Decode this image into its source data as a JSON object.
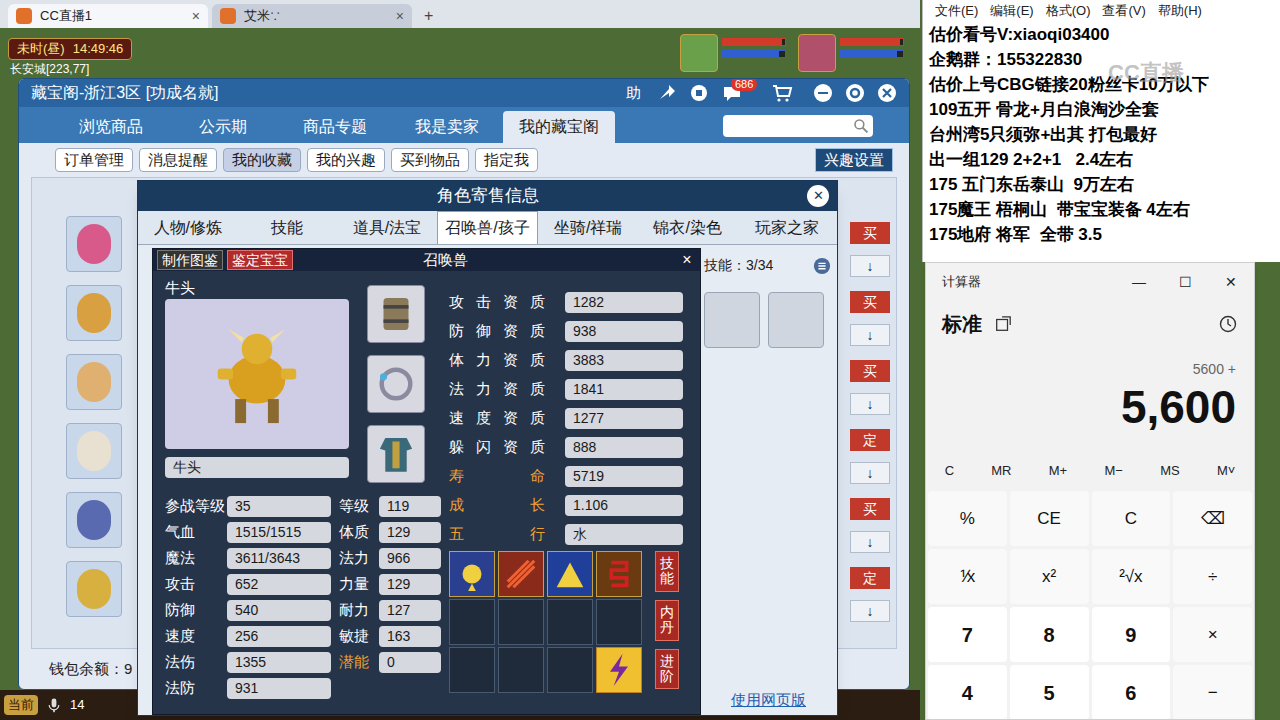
{
  "browser_tabs": [
    {
      "label": "CC直播1",
      "close": "×",
      "selected": true
    },
    {
      "label": "艾米∵",
      "close": "×",
      "selected": false
    }
  ],
  "browser_new_tab": "+",
  "hud": {
    "period": "未时(昼)",
    "clock": "14:49:46",
    "location": "长安城[223,77]",
    "bars": [
      {
        "level": 0.95,
        "color": "#d23a2a"
      },
      {
        "level": 0.9,
        "color": "#2f5fd0"
      },
      {
        "level": 0.95,
        "color": "#d23a2a"
      },
      {
        "level": 0.9,
        "color": "#2f5fd0"
      }
    ]
  },
  "cbg_window": {
    "title": "藏宝阁-浙江3区 [功成名就]",
    "help": "助",
    "badge": "686",
    "tabs": [
      {
        "label": "浏览商品",
        "selected": false
      },
      {
        "label": "公示期",
        "selected": false
      },
      {
        "label": "商品专题",
        "selected": false
      },
      {
        "label": "我是卖家",
        "selected": false
      },
      {
        "label": "我的藏宝阁",
        "selected": true
      }
    ],
    "subtabs": [
      {
        "label": "订单管理",
        "selected": false
      },
      {
        "label": "消息提醒",
        "selected": false
      },
      {
        "label": "我的收藏",
        "selected": true
      },
      {
        "label": "我的兴趣",
        "selected": false
      },
      {
        "label": "买到物品",
        "selected": false
      },
      {
        "label": "指定我",
        "selected": false
      }
    ],
    "interest_settings": "兴趣设置",
    "rows": [
      {
        "button": "买",
        "sort": "↓"
      },
      {
        "button": "买",
        "sort": "↓"
      },
      {
        "button": "买",
        "sort": "↓"
      },
      {
        "button": "定",
        "sort": "↓"
      },
      {
        "button": "买",
        "sort": "↓"
      },
      {
        "button": "定",
        "sort": "↓"
      }
    ],
    "wallet": "钱包余额：9"
  },
  "dialog": {
    "title": "角色寄售信息",
    "close": "✕",
    "tabs": [
      {
        "label": "人物/修炼",
        "selected": false
      },
      {
        "label": "技能",
        "selected": false
      },
      {
        "label": "道具/法宝",
        "selected": false
      },
      {
        "label": "召唤兽/孩子",
        "selected": true
      },
      {
        "label": "坐骑/祥瑞",
        "selected": false
      },
      {
        "label": "锦衣/染色",
        "selected": false
      },
      {
        "label": "玩家之家",
        "selected": false
      }
    ],
    "skill_count": "技能：3/34",
    "web_link": "使用网页版"
  },
  "pet_window": {
    "make_atlas": "制作图鉴",
    "identify": "鉴定宝宝",
    "title": "召唤兽",
    "close": "×",
    "name": "牛头",
    "name_field": "牛头",
    "equipment": [
      {
        "filled": true
      },
      {
        "filled": true
      },
      {
        "filled": true
      }
    ],
    "stats": [
      [
        {
          "label": "参战等级",
          "value": "35",
          "color": "#ffffff"
        },
        {
          "label": "等级",
          "value": "119",
          "color": "#ffffff"
        }
      ],
      [
        {
          "label": "气血",
          "value": "1515/1515",
          "color": "#ffffff"
        },
        {
          "label": "体质",
          "value": "129",
          "color": "#ffffff"
        }
      ],
      [
        {
          "label": "魔法",
          "value": "3611/3643",
          "color": "#ffffff"
        },
        {
          "label": "法力",
          "value": "966",
          "color": "#ffffff"
        }
      ],
      [
        {
          "label": "攻击",
          "value": "652",
          "color": "#ffffff"
        },
        {
          "label": "力量",
          "value": "129",
          "color": "#ffffff"
        }
      ],
      [
        {
          "label": "防御",
          "value": "540",
          "color": "#ffffff"
        },
        {
          "label": "耐力",
          "value": "127",
          "color": "#ffffff"
        }
      ],
      [
        {
          "label": "速度",
          "value": "256",
          "color": "#ffffff"
        },
        {
          "label": "敏捷",
          "value": "163",
          "color": "#ffffff"
        }
      ],
      [
        {
          "label": "法伤",
          "value": "1355",
          "color": "#ffffff"
        },
        {
          "label": "潜能",
          "value": "0",
          "color": "#f0a030"
        }
      ],
      [
        {
          "label": "法防",
          "value": "931",
          "color": "#ffffff"
        }
      ]
    ],
    "aptitudes": [
      {
        "label": "攻击资质",
        "value": "1282",
        "color": "#ffffff"
      },
      {
        "label": "防御资质",
        "value": "938",
        "color": "#ffffff"
      },
      {
        "label": "体力资质",
        "value": "3883",
        "color": "#ffffff"
      },
      {
        "label": "法力资质",
        "value": "1841",
        "color": "#ffffff"
      },
      {
        "label": "速度资质",
        "value": "1277",
        "color": "#ffffff"
      },
      {
        "label": "躲闪资质",
        "value": "888",
        "color": "#ffffff"
      },
      {
        "label": "寿命",
        "value": "5719",
        "color": "#f0a030"
      },
      {
        "label": "成长",
        "value": "1.106",
        "color": "#f0a030"
      },
      {
        "label": "五行",
        "value": "水",
        "color": "#f0a030"
      }
    ],
    "skill_slots": [
      {
        "filled": true,
        "kind": "skill"
      },
      {
        "filled": true,
        "kind": "skill"
      },
      {
        "filled": true,
        "kind": "skill"
      },
      {
        "filled": true,
        "kind": "skill"
      },
      {
        "filled": false,
        "kind": "empty"
      },
      {
        "filled": false,
        "kind": "empty"
      },
      {
        "filled": false,
        "kind": "empty"
      },
      {
        "filled": false,
        "kind": "empty"
      },
      {
        "filled": false,
        "kind": "empty"
      },
      {
        "filled": false,
        "kind": "empty"
      },
      {
        "filled": false,
        "kind": "empty"
      },
      {
        "filled": true,
        "kind": "special"
      }
    ],
    "side_buttons": [
      "技能",
      "内丹",
      "进阶"
    ]
  },
  "notepad": {
    "menu": [
      "文件(E)",
      "编辑(E)",
      "格式(O)",
      "查看(V)",
      "帮助(H)"
    ],
    "lines": [
      "估价看号V:xiaoqi03400",
      "企鹅群：155322830",
      "估价上号CBG链接20粉丝卡10万以下",
      "109五开 骨龙+月白浪淘沙全套",
      "台州湾5只须弥+出其 打包最好",
      "出一组129 2+2+1   2.4左右",
      "175 五门东岳泰山  9万左右",
      "175魔王 梧桐山  带宝宝装备 4左右",
      "175地府 将军  全带 3.5"
    ],
    "watermark": "CC直播"
  },
  "calculator": {
    "title": "计算器",
    "controls": [
      "—",
      "☐",
      "✕"
    ],
    "mode": "标准",
    "expression": "5600 +",
    "display": "5,600",
    "memory": [
      "C",
      "MR",
      "M+",
      "M−",
      "MS",
      "M˅"
    ],
    "keys": [
      [
        {
          "label": "%",
          "kind": "op"
        },
        {
          "label": "CE",
          "kind": "op"
        },
        {
          "label": "C",
          "kind": "op"
        },
        {
          "label": "⌫",
          "kind": "op"
        }
      ],
      [
        {
          "label": "⅟x",
          "kind": "op"
        },
        {
          "label": "x²",
          "kind": "op"
        },
        {
          "label": "²√x",
          "kind": "op"
        },
        {
          "label": "÷",
          "kind": "op"
        }
      ],
      [
        {
          "label": "7",
          "kind": "digit"
        },
        {
          "label": "8",
          "kind": "digit"
        },
        {
          "label": "9",
          "kind": "digit"
        },
        {
          "label": "×",
          "kind": "op"
        }
      ],
      [
        {
          "label": "4",
          "kind": "digit"
        },
        {
          "label": "5",
          "kind": "digit"
        },
        {
          "label": "6",
          "kind": "digit"
        },
        {
          "label": "−",
          "kind": "op"
        }
      ]
    ]
  },
  "taskbar": {
    "label": "当前",
    "count": "14"
  }
}
